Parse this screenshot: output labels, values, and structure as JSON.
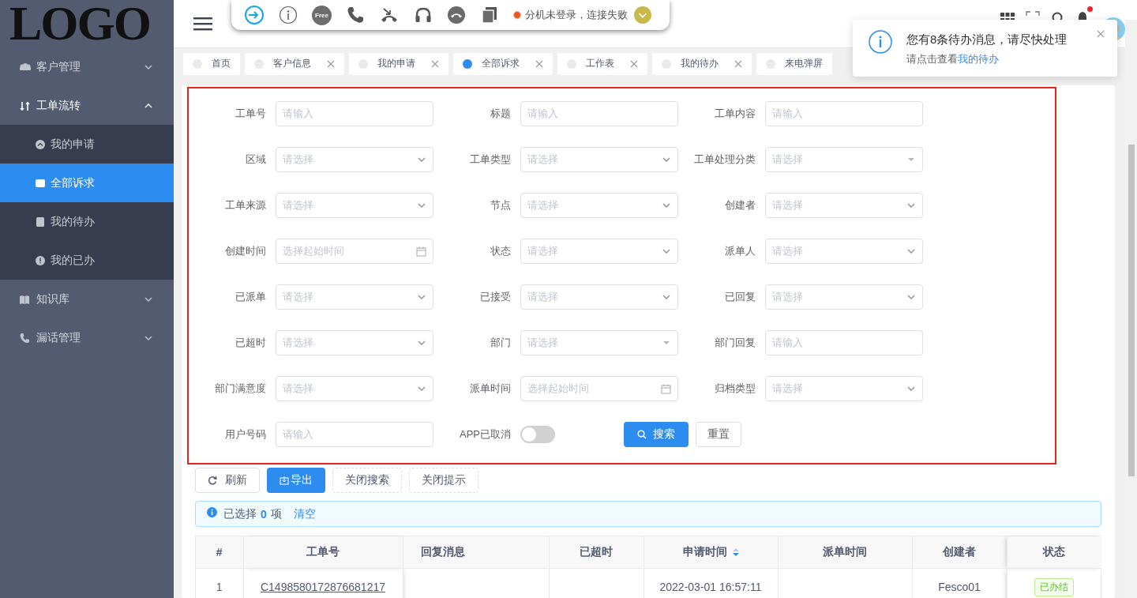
{
  "sidebar": {
    "logo": "LOGO",
    "items": [
      {
        "label": "客户管理",
        "kind": "users",
        "expanded": false
      },
      {
        "label": "工单流转",
        "kind": "flow",
        "expanded": true,
        "children": [
          {
            "label": "我的申请",
            "kind": "up",
            "selected": false
          },
          {
            "label": "全部诉求",
            "kind": "folder",
            "selected": true
          },
          {
            "label": "我的待办",
            "kind": "doc",
            "selected": false
          },
          {
            "label": "我的已办",
            "kind": "alert",
            "selected": false
          }
        ]
      },
      {
        "label": "知识库",
        "kind": "book",
        "expanded": false
      },
      {
        "label": "漏话管理",
        "kind": "phone",
        "expanded": false
      }
    ]
  },
  "phone_bar": {
    "free_label": "Free",
    "status": "分机未登录，连接失败"
  },
  "tabs": [
    {
      "label": "首页",
      "selected": false,
      "closable": false
    },
    {
      "label": "客户信息",
      "selected": false,
      "closable": true
    },
    {
      "label": "我的申请",
      "selected": false,
      "closable": true
    },
    {
      "label": "全部诉求",
      "selected": true,
      "closable": true
    },
    {
      "label": "工作表",
      "selected": false,
      "closable": true
    },
    {
      "label": "我的待办",
      "selected": false,
      "closable": true
    },
    {
      "label": "来电弹屏",
      "selected": false,
      "closable": false
    }
  ],
  "notification": {
    "title": "您有8条待办消息，请尽快处理",
    "text": "请点击查看",
    "link": "我的待办"
  },
  "search_form": {
    "fields": [
      {
        "label": "工单号",
        "kind": "input",
        "placeholder": "请输入"
      },
      {
        "label": "标题",
        "kind": "input",
        "placeholder": "请输入"
      },
      {
        "label": "工单内容",
        "kind": "input",
        "placeholder": "请输入"
      },
      {
        "label": "区域",
        "kind": "select",
        "placeholder": "请选择"
      },
      {
        "label": "工单类型",
        "kind": "select",
        "placeholder": "请选择"
      },
      {
        "label": "工单处理分类",
        "kind": "cascader",
        "placeholder": "请选择"
      },
      {
        "label": "工单来源",
        "kind": "select",
        "placeholder": "请选择"
      },
      {
        "label": "节点",
        "kind": "select",
        "placeholder": "请选择"
      },
      {
        "label": "创建者",
        "kind": "select",
        "placeholder": "请选择"
      },
      {
        "label": "创建时间",
        "kind": "date",
        "placeholder": "选择起始时间"
      },
      {
        "label": "状态",
        "kind": "select",
        "placeholder": "请选择"
      },
      {
        "label": "派单人",
        "kind": "select",
        "placeholder": "请选择"
      },
      {
        "label": "已派单",
        "kind": "select",
        "placeholder": "请选择"
      },
      {
        "label": "已接受",
        "kind": "select",
        "placeholder": "请选择"
      },
      {
        "label": "已回复",
        "kind": "select",
        "placeholder": "请选择"
      },
      {
        "label": "已超时",
        "kind": "select",
        "placeholder": "请选择"
      },
      {
        "label": "部门",
        "kind": "cascader",
        "placeholder": "请选择"
      },
      {
        "label": "部门回复",
        "kind": "input",
        "placeholder": "请输入"
      },
      {
        "label": "部门满意度",
        "kind": "select",
        "placeholder": "请选择"
      },
      {
        "label": "派单时间",
        "kind": "date",
        "placeholder": "选择起始时间"
      },
      {
        "label": "归档类型",
        "kind": "select",
        "placeholder": "请选择"
      },
      {
        "label": "用户号码",
        "kind": "input",
        "placeholder": "请输入"
      },
      {
        "label": "APP已取消",
        "kind": "switch",
        "on": false
      }
    ],
    "buttons": [
      {
        "label": "搜索",
        "kind": "primary"
      },
      {
        "label": "重置",
        "kind": "default"
      }
    ]
  },
  "toolbar": {
    "buttons": [
      {
        "label": "刷新",
        "kind": "refresh"
      },
      {
        "label": "导出",
        "kind": "export"
      },
      {
        "label": "关闭搜索",
        "kind": "dashed"
      },
      {
        "label": "关闭提示",
        "kind": "dashed"
      }
    ]
  },
  "selection_alert": {
    "prefix": "已选择",
    "count": "0",
    "suffix": "项",
    "clear": "清空"
  },
  "table": {
    "columns": [
      {
        "label": "#",
        "sortable": false
      },
      {
        "label": "工单号",
        "sortable": false
      },
      {
        "label": "回复消息",
        "sortable": false
      },
      {
        "label": "已超时",
        "sortable": false
      },
      {
        "label": "申请时间",
        "sortable": true
      },
      {
        "label": "派单时间",
        "sortable": false
      },
      {
        "label": "创建者",
        "sortable": false
      },
      {
        "label": "状态",
        "sortable": false
      }
    ],
    "rows": [
      {
        "cells": [
          {
            "kind": "text",
            "text": "1"
          },
          {
            "kind": "link",
            "text": "C1498580172876681217"
          },
          null,
          null,
          {
            "kind": "text",
            "text": "2022-03-01 16:57:11"
          },
          null,
          {
            "kind": "text",
            "text": "Fesco01"
          },
          {
            "kind": "tag",
            "text": "已办结"
          }
        ]
      }
    ]
  }
}
